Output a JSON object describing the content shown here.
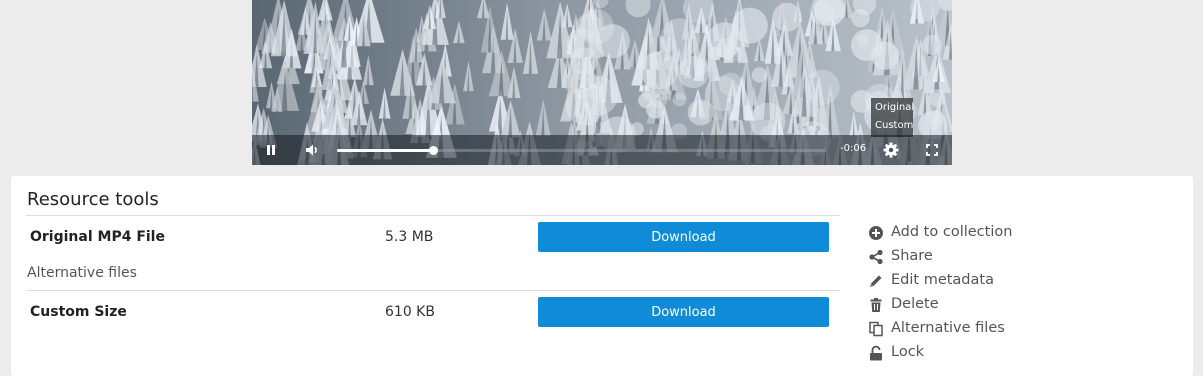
{
  "player": {
    "time_remaining": "-0:06",
    "progress_fraction": 0.197,
    "quality_options": [
      "Original",
      "Custom"
    ],
    "icons": {
      "play_pause": "pause-icon",
      "volume": "volume-icon",
      "settings": "gear-icon",
      "fullscreen": "fullscreen-icon"
    }
  },
  "resource_tools": {
    "title": "Resource tools",
    "files": [
      {
        "name": "Original MP4 File",
        "size": "5.3 MB",
        "button": "Download"
      }
    ],
    "alternative_heading": "Alternative files",
    "alternatives": [
      {
        "name": "Custom Size",
        "size": "610 KB",
        "button": "Download"
      }
    ],
    "accent_color": "#0f8bd8"
  },
  "actions": [
    {
      "label": "Add to collection",
      "icon": "plus-circle-icon"
    },
    {
      "label": "Share",
      "icon": "share-icon"
    },
    {
      "label": "Edit metadata",
      "icon": "pencil-icon"
    },
    {
      "label": "Delete",
      "icon": "trash-icon"
    },
    {
      "label": "Alternative files",
      "icon": "files-icon"
    },
    {
      "label": "Lock",
      "icon": "unlock-icon"
    }
  ]
}
